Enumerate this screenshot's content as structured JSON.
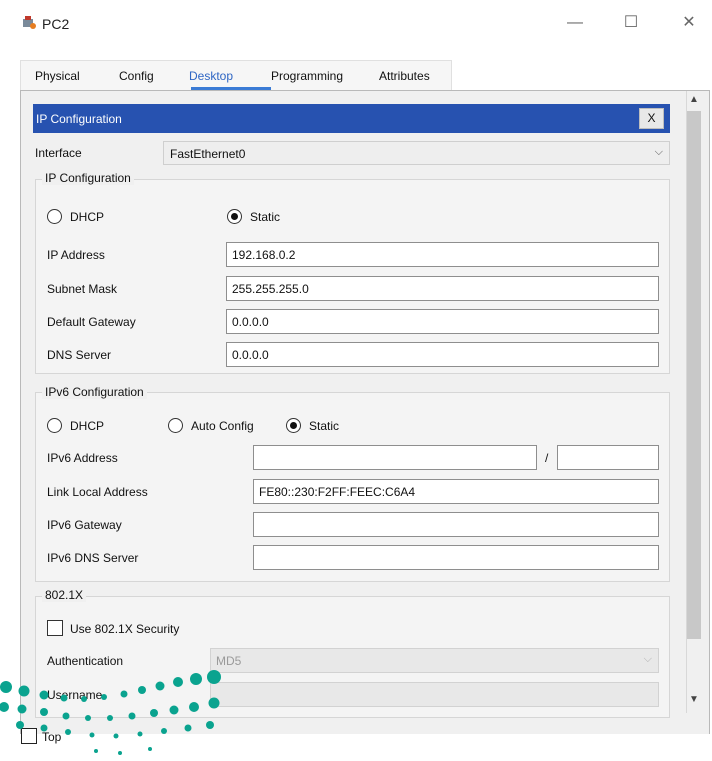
{
  "window": {
    "title": "PC2",
    "minimize": "—",
    "maximize": "☐",
    "close": "✕",
    "icon": "packet-tracer-pc-icon"
  },
  "tabs": [
    {
      "label": "Physical"
    },
    {
      "label": "Config"
    },
    {
      "label": "Desktop",
      "active": true
    },
    {
      "label": "Programming"
    },
    {
      "label": "Attributes"
    }
  ],
  "panel": {
    "title": "IP Configuration",
    "close": "X"
  },
  "interface": {
    "label": "Interface",
    "value": "FastEthernet0"
  },
  "ipv4": {
    "legend": "IP Configuration",
    "dhcp": "DHCP",
    "static": "Static",
    "mode": "Static",
    "ip": {
      "label": "IP Address",
      "value": "192.168.0.2"
    },
    "mask": {
      "label": "Subnet Mask",
      "value": "255.255.255.0"
    },
    "gateway": {
      "label": "Default Gateway",
      "value": "0.0.0.0"
    },
    "dns": {
      "label": "DNS Server",
      "value": "0.0.0.0"
    }
  },
  "ipv6": {
    "legend": "IPv6 Configuration",
    "dhcp": "DHCP",
    "auto": "Auto Config",
    "static": "Static",
    "mode": "Static",
    "address": {
      "label": "IPv6 Address",
      "value": "",
      "prefix": "",
      "slash": "/"
    },
    "link_local": {
      "label": "Link Local Address",
      "value": "FE80::230:F2FF:FEEC:C6A4"
    },
    "gateway": {
      "label": "IPv6 Gateway",
      "value": ""
    },
    "dns": {
      "label": "IPv6 DNS Server",
      "value": ""
    }
  },
  "dot1x": {
    "legend": "802.1X",
    "use_security": "Use 802.1X Security",
    "auth": {
      "label": "Authentication",
      "value": "MD5"
    },
    "username": {
      "label": "Username",
      "value": ""
    }
  },
  "footer": {
    "top_label": "Top"
  },
  "colors": {
    "panel_header": "#2752b0",
    "active_tab": "#2f66c4",
    "watermark_teal": "#0aa38f"
  }
}
